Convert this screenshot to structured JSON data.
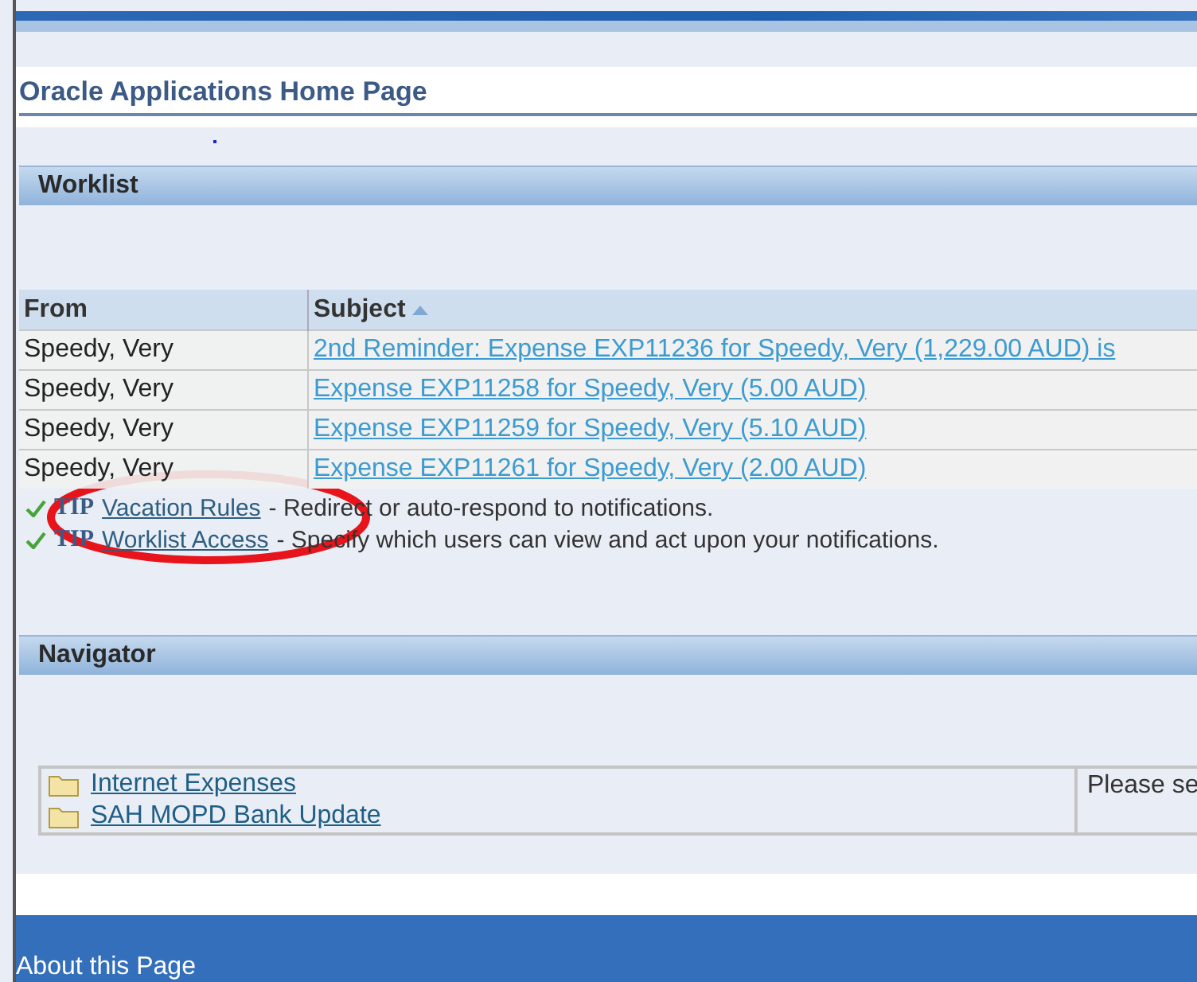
{
  "page_title": "Oracle Applications Home Page",
  "worklist": {
    "heading": "Worklist",
    "columns": [
      {
        "label": "From",
        "sorted": false
      },
      {
        "label": "Subject",
        "sorted": true
      }
    ],
    "rows": [
      {
        "from": "Speedy, Very",
        "subject": "2nd Reminder: Expense EXP11236 for Speedy, Very (1,229.00 AUD) is"
      },
      {
        "from": "Speedy, Very",
        "subject": "Expense EXP11258 for Speedy, Very (5.00 AUD)"
      },
      {
        "from": "Speedy, Very",
        "subject": "Expense EXP11259 for Speedy, Very (5.10 AUD)"
      },
      {
        "from": "Speedy, Very",
        "subject": "Expense EXP11261 for Speedy, Very (2.00 AUD)"
      }
    ],
    "tips": [
      {
        "label": "TIP",
        "link": "Vacation Rules",
        "text": "- Redirect or auto-respond to notifications."
      },
      {
        "label": "TIP",
        "link": "Worklist Access",
        "text": "- Specify which users can view and act upon your notifications."
      }
    ]
  },
  "navigator": {
    "heading": "Navigator",
    "items": [
      "Internet Expenses",
      "SAH MOPD Bank Update"
    ],
    "description": "Please se"
  },
  "footer": {
    "link": "About this Page"
  },
  "annotations": [
    {
      "kind": "ellipse",
      "color": "#e8141b"
    }
  ]
}
